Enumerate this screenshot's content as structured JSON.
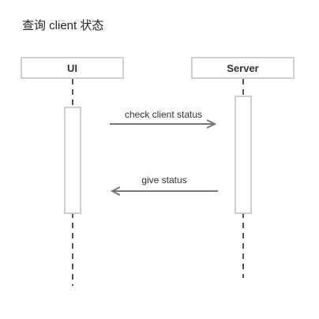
{
  "title": "查询 client 状态",
  "participants": [
    {
      "id": "ui",
      "label": "UI"
    },
    {
      "id": "server",
      "label": "Server"
    }
  ],
  "messages": [
    {
      "from": "ui",
      "to": "server",
      "label": "check client status"
    },
    {
      "from": "server",
      "to": "ui",
      "label": "give status"
    }
  ],
  "colors": {
    "border": "#cfcfcf",
    "arrow": "#777777",
    "lifeline": "#555555",
    "text": "#333333"
  }
}
